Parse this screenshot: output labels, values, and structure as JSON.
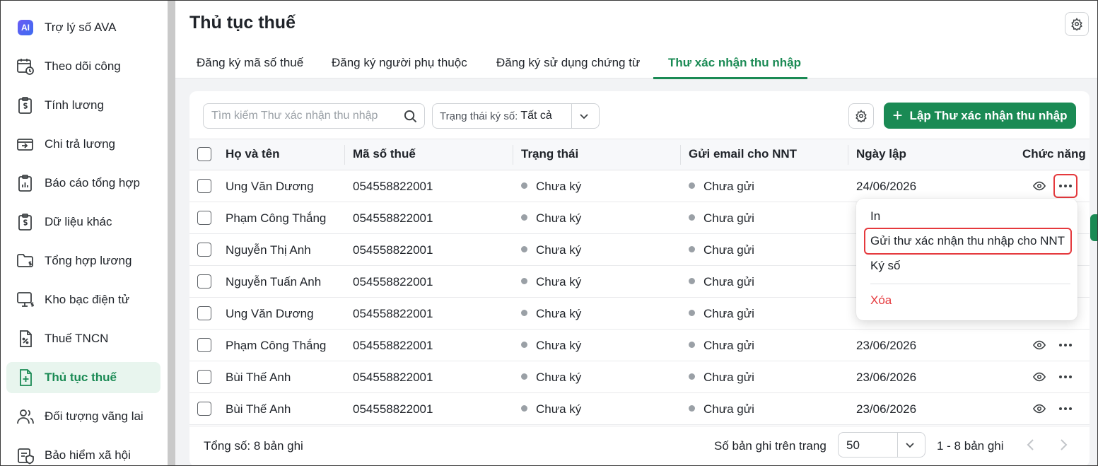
{
  "sidebar": {
    "items": [
      {
        "label": "Trợ lý số AVA",
        "icon": "ai-assistant-icon"
      },
      {
        "label": "Theo dõi công",
        "icon": "calendar-clock-icon"
      },
      {
        "label": "Tính lương",
        "icon": "clipboard-dollar-icon"
      },
      {
        "label": "Chi trả lương",
        "icon": "wallet-transfer-icon"
      },
      {
        "label": "Báo cáo tổng hợp",
        "icon": "report-chart-icon"
      },
      {
        "label": "Dữ liệu khác",
        "icon": "clipboard-data-icon"
      },
      {
        "label": "Tổng hợp lương",
        "icon": "folder-dollar-icon"
      },
      {
        "label": "Kho bạc điện tử",
        "icon": "monitor-dollar-icon"
      },
      {
        "label": "Thuế TNCN",
        "icon": "tax-document-icon"
      },
      {
        "label": "Thủ tục thuế",
        "icon": "document-plus-icon"
      },
      {
        "label": "Đối tượng vãng lai",
        "icon": "people-icon"
      },
      {
        "label": "Bảo hiểm xã hội",
        "icon": "insurance-icon"
      }
    ],
    "active_index": 9,
    "ai_badge": "AI"
  },
  "header": {
    "title": "Thủ tục thuế",
    "tabs": [
      {
        "label": "Đăng ký mã số thuế"
      },
      {
        "label": "Đăng ký người phụ thuộc"
      },
      {
        "label": "Đăng ký sử dụng chứng từ"
      },
      {
        "label": "Thư xác nhận thu nhập"
      }
    ],
    "active_tab": 3
  },
  "toolbar": {
    "search_placeholder": "Tìm kiếm Thư xác nhận thu nhập",
    "filter_label": "Trạng thái ký số:",
    "filter_value": "Tất cả",
    "create_label": "Lập Thư xác nhận thu nhập"
  },
  "table": {
    "columns": [
      "Họ và tên",
      "Mã số thuế",
      "Trạng thái",
      "Gửi email cho NNT",
      "Ngày lập",
      "Chức năng"
    ],
    "rows": [
      {
        "name": "Ung Văn Dương",
        "tax_code": "054558822001",
        "status": "Chưa ký",
        "email": "Chưa gửi",
        "date": "24/06/2026"
      },
      {
        "name": "Phạm Công Thắng",
        "tax_code": "054558822001",
        "status": "Chưa ký",
        "email": "Chưa gửi",
        "date": ""
      },
      {
        "name": "Nguyễn Thị Anh",
        "tax_code": "054558822001",
        "status": "Chưa ký",
        "email": "Chưa gửi",
        "date": ""
      },
      {
        "name": "Nguyễn Tuấn Anh",
        "tax_code": "054558822001",
        "status": "Chưa ký",
        "email": "Chưa gửi",
        "date": ""
      },
      {
        "name": "Ung Văn Dương",
        "tax_code": "054558822001",
        "status": "Chưa ký",
        "email": "Chưa gửi",
        "date": ""
      },
      {
        "name": "Phạm Công Thắng",
        "tax_code": "054558822001",
        "status": "Chưa ký",
        "email": "Chưa gửi",
        "date": "23/06/2026"
      },
      {
        "name": "Bùi Thế Anh",
        "tax_code": "054558822001",
        "status": "Chưa ký",
        "email": "Chưa gửi",
        "date": "23/06/2026"
      },
      {
        "name": "Bùi Thế Anh",
        "tax_code": "054558822001",
        "status": "Chưa ký",
        "email": "Chưa gửi",
        "date": "23/06/2026"
      }
    ]
  },
  "context_menu": {
    "items": [
      {
        "label": "In"
      },
      {
        "label": "Gửi thư xác nhận thu nhập cho NNT"
      },
      {
        "label": "Ký số"
      },
      {
        "label": "Xóa"
      }
    ]
  },
  "footer": {
    "total": "Tổng số: 8 bản ghi",
    "per_page_label": "Số bản ghi trên trang",
    "per_page_value": "50",
    "range": "1 - 8 bản ghi"
  },
  "colors": {
    "accent": "#1a8a54",
    "highlight": "#e5393d",
    "status_dot": "#9aa0a6"
  }
}
